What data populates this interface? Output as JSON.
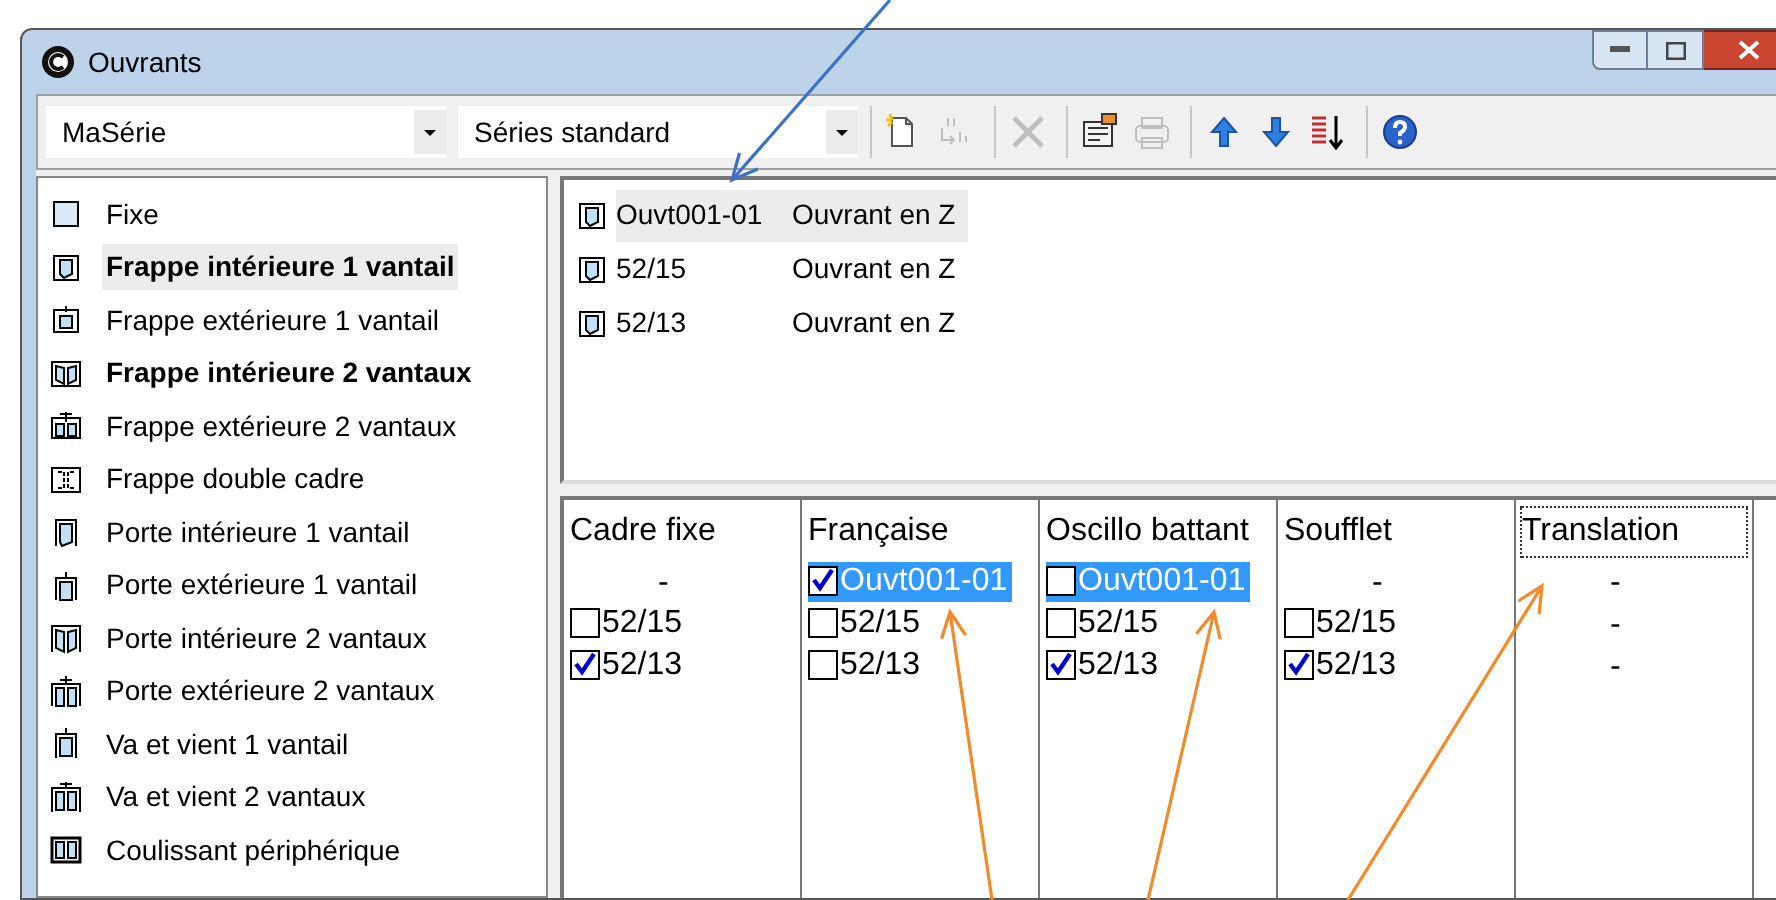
{
  "window": {
    "title": "Ouvrants"
  },
  "toolbar": {
    "series_combo": {
      "value": "MaSérie"
    },
    "standard_combo": {
      "value": "Séries standard"
    },
    "tool_groups": [
      [
        {
          "kind": "new",
          "disabled": false
        },
        {
          "kind": "rename",
          "disabled": true
        }
      ],
      [
        {
          "kind": "delete",
          "disabled": true
        }
      ],
      [
        {
          "kind": "properties",
          "disabled": false
        },
        {
          "kind": "print",
          "disabled": true
        }
      ],
      [
        {
          "kind": "up",
          "disabled": false
        },
        {
          "kind": "down",
          "disabled": false
        },
        {
          "kind": "sort",
          "disabled": false
        }
      ],
      [
        {
          "kind": "help",
          "disabled": false
        }
      ]
    ]
  },
  "types": [
    {
      "label": "Fixe",
      "kind": "fixed",
      "bold": false,
      "selected": false
    },
    {
      "label": "Frappe intérieure 1 vantail",
      "kind": "in1",
      "bold": true,
      "selected": true
    },
    {
      "label": "Frappe extérieure 1 vantail",
      "kind": "out1",
      "bold": false,
      "selected": false
    },
    {
      "label": "Frappe intérieure 2 vantaux",
      "kind": "in2",
      "bold": true,
      "selected": false
    },
    {
      "label": "Frappe extérieure 2 vantaux",
      "kind": "out2",
      "bold": false,
      "selected": false
    },
    {
      "label": "Frappe double cadre",
      "kind": "double",
      "bold": false,
      "selected": false
    },
    {
      "label": "Porte intérieure 1 vantail",
      "kind": "door1",
      "bold": false,
      "selected": false
    },
    {
      "label": "Porte extérieure 1 vantail",
      "kind": "door1out",
      "bold": false,
      "selected": false
    },
    {
      "label": "Porte intérieure 2 vantaux",
      "kind": "door2",
      "bold": false,
      "selected": false
    },
    {
      "label": "Porte extérieure 2 vantaux",
      "kind": "door2out",
      "bold": false,
      "selected": false
    },
    {
      "label": "Va et vient 1 vantail",
      "kind": "swing1",
      "bold": false,
      "selected": false
    },
    {
      "label": "Va et vient 2 vantaux",
      "kind": "swing2",
      "bold": false,
      "selected": false
    },
    {
      "label": "Coulissant périphérique",
      "kind": "sliding",
      "bold": false,
      "selected": false
    }
  ],
  "series": [
    {
      "code": "Ouvt001-01",
      "type": "Ouvrant en Z",
      "selected": true
    },
    {
      "code": "52/15",
      "type": "Ouvrant en Z",
      "selected": false
    },
    {
      "code": "52/13",
      "type": "Ouvrant en Z",
      "selected": false
    }
  ],
  "columns": [
    {
      "title": "Cadre fixe",
      "focused": false,
      "items": [
        {
          "kind": "dash",
          "label": "-"
        },
        {
          "kind": "check",
          "label": "52/15",
          "checked": false,
          "selected": false
        },
        {
          "kind": "check",
          "label": "52/13",
          "checked": true,
          "selected": false
        }
      ]
    },
    {
      "title": "Française",
      "focused": false,
      "items": [
        {
          "kind": "check",
          "label": "Ouvt001-01",
          "checked": true,
          "selected": true
        },
        {
          "kind": "check",
          "label": "52/15",
          "checked": false,
          "selected": false
        },
        {
          "kind": "check",
          "label": "52/13",
          "checked": false,
          "selected": false
        }
      ]
    },
    {
      "title": "Oscillo battant",
      "focused": false,
      "items": [
        {
          "kind": "check",
          "label": "Ouvt001-01",
          "checked": false,
          "selected": true
        },
        {
          "kind": "check",
          "label": "52/15",
          "checked": false,
          "selected": false
        },
        {
          "kind": "check",
          "label": "52/13",
          "checked": true,
          "selected": false
        }
      ]
    },
    {
      "title": "Soufflet",
      "focused": false,
      "items": [
        {
          "kind": "dash",
          "label": "-"
        },
        {
          "kind": "check",
          "label": "52/15",
          "checked": false,
          "selected": false
        },
        {
          "kind": "check",
          "label": "52/13",
          "checked": true,
          "selected": false
        }
      ]
    },
    {
      "title": "Translation",
      "focused": true,
      "items": [
        {
          "kind": "dash",
          "label": "-"
        },
        {
          "kind": "dash",
          "label": "-"
        },
        {
          "kind": "dash",
          "label": "-"
        }
      ]
    }
  ]
}
